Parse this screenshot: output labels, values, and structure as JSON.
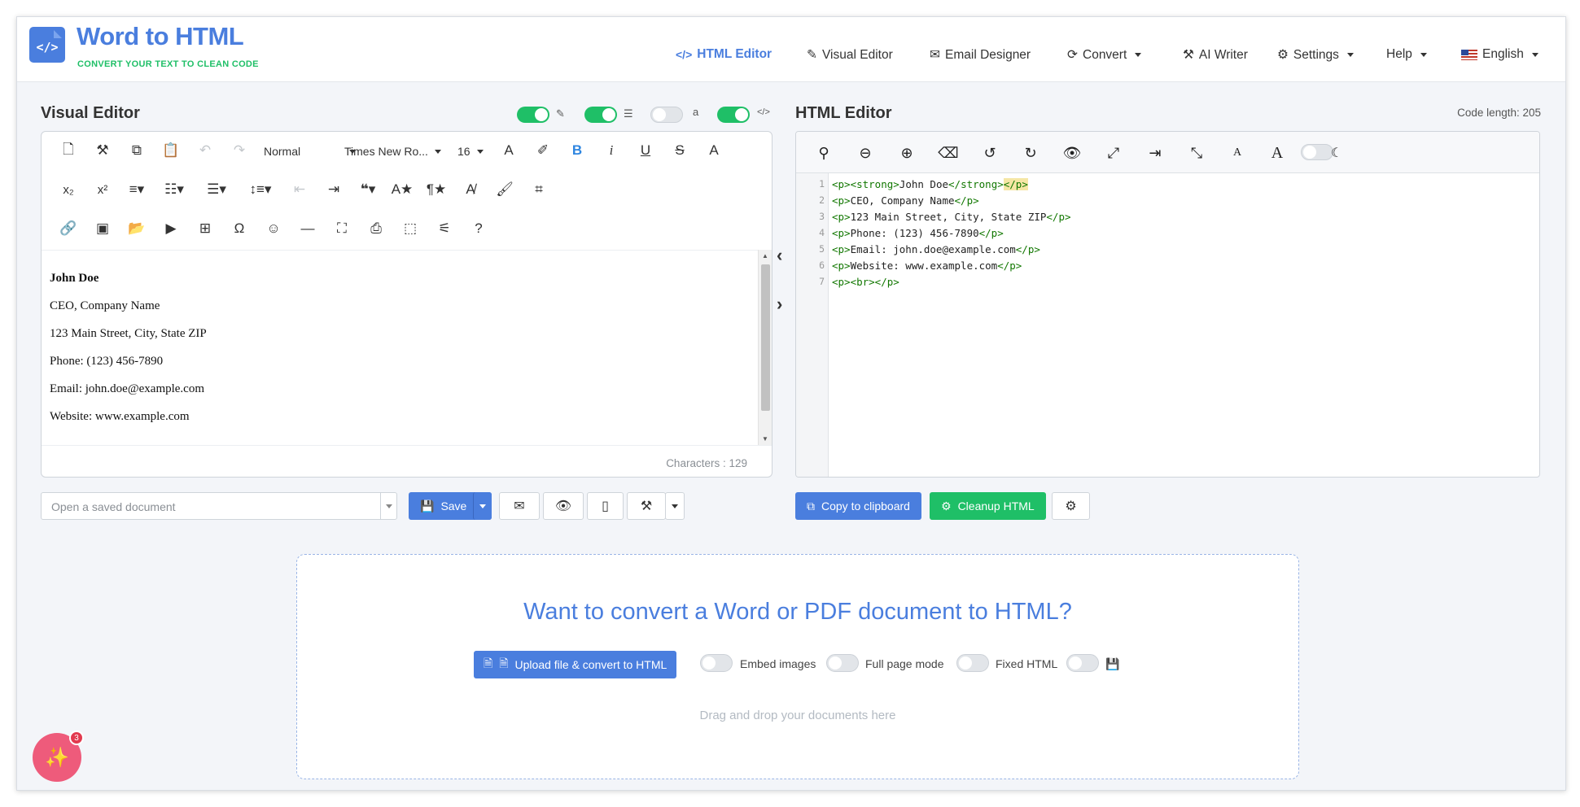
{
  "brand": {
    "title": "Word to HTML",
    "subtitle": "CONVERT YOUR TEXT TO CLEAN CODE"
  },
  "nav": [
    {
      "label": "HTML Editor",
      "icon": "</>",
      "active": true
    },
    {
      "label": "Visual Editor",
      "icon": "edit-icon"
    },
    {
      "label": "Email Designer",
      "icon": "envelope-icon"
    },
    {
      "label": "Convert",
      "icon": "refresh-icon",
      "dropdown": true
    },
    {
      "label": "AI Writer",
      "icon": "magic-wand-icon"
    },
    {
      "label": "Settings",
      "icon": "gear-icon",
      "dropdown": true
    },
    {
      "label": "Help",
      "dropdown": true
    },
    {
      "label": "English",
      "icon": "us-flag-icon",
      "dropdown": true
    }
  ],
  "visual_editor": {
    "title": "Visual Editor",
    "toolbar": {
      "block_format": "Normal",
      "font_family": "Times New Ro...",
      "font_size": "16"
    },
    "content": [
      "John Doe",
      "CEO, Company Name",
      "123 Main Street, City, State ZIP",
      "Phone: (123) 456-7890",
      "Email: john.doe@example.com",
      "Website: www.example.com"
    ],
    "characters": "Characters : 129"
  },
  "html_editor": {
    "title": "HTML Editor",
    "code_length": "Code length: 205",
    "line_numbers": [
      "1",
      "2",
      "3",
      "4",
      "5",
      "6",
      "7"
    ]
  },
  "bottom": {
    "open_doc_placeholder": "Open a saved document",
    "save_label": "Save",
    "copy_label": "Copy to clipboard",
    "cleanup_label": "Cleanup HTML"
  },
  "upload": {
    "title": "Want to convert a Word or PDF document to HTML?",
    "button_label": "Upload file & convert to HTML",
    "embed_images": "Embed images",
    "full_page_mode": "Full page mode",
    "fixed_html": "Fixed HTML",
    "drag_text": "Drag and drop your documents here"
  },
  "fab": {
    "badge_count": "3"
  },
  "colors": {
    "primary": "#4a7ede",
    "success": "#1fbf67",
    "tag": "#117700"
  }
}
